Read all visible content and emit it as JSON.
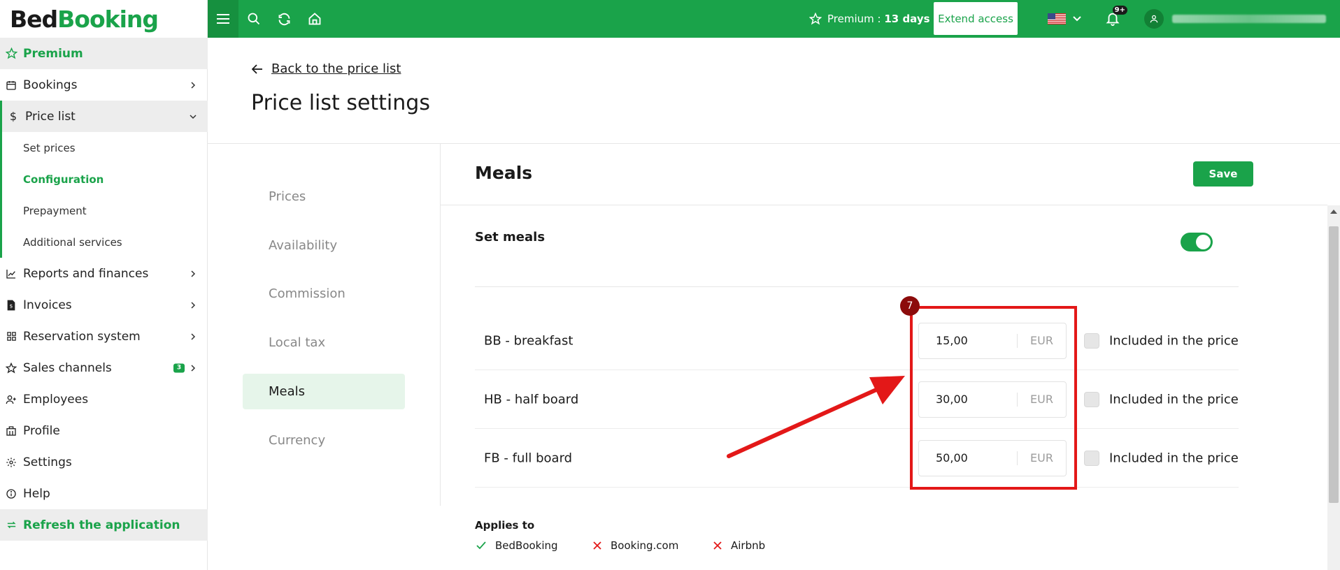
{
  "brand": {
    "part1": "Bed",
    "part2": "Booking"
  },
  "sidebar": {
    "premium": "Premium",
    "bookings": "Bookings",
    "price_list": "Price list",
    "sub": [
      "Set prices",
      "Configuration",
      "Prepayment",
      "Additional services"
    ],
    "reports": "Reports and finances",
    "invoices": "Invoices",
    "reservation": "Reservation system",
    "sales_channels": "Sales channels",
    "sales_badge": "3",
    "employees": "Employees",
    "profile": "Profile",
    "settings": "Settings",
    "help": "Help",
    "refresh": "Refresh the application"
  },
  "topbar": {
    "premium_label": "Premium : ",
    "premium_days": "13 days",
    "extend": "Extend access",
    "notif_count": "9+"
  },
  "page": {
    "back": "Back to the price list",
    "title": "Price list settings"
  },
  "settings_menu": [
    "Prices",
    "Availability",
    "Commission",
    "Local tax",
    "Meals",
    "Currency"
  ],
  "content": {
    "title": "Meals",
    "save": "Save",
    "set_meals": "Set meals",
    "meals": [
      {
        "name": "BB - breakfast",
        "price": "15,00",
        "currency": "EUR",
        "included": "Included in the price"
      },
      {
        "name": "HB - half board",
        "price": "30,00",
        "currency": "EUR",
        "included": "Included in the price"
      },
      {
        "name": "FB - full board",
        "price": "50,00",
        "currency": "EUR",
        "included": "Included in the price"
      }
    ],
    "applies_to": "Applies to",
    "channels": [
      {
        "name": "BedBooking",
        "enabled": true
      },
      {
        "name": "Booking.com",
        "enabled": false
      },
      {
        "name": "Airbnb",
        "enabled": false
      }
    ]
  },
  "annotation": {
    "number": "7"
  },
  "colors": {
    "accent": "#1aa34a",
    "annotation": "#e31818"
  }
}
